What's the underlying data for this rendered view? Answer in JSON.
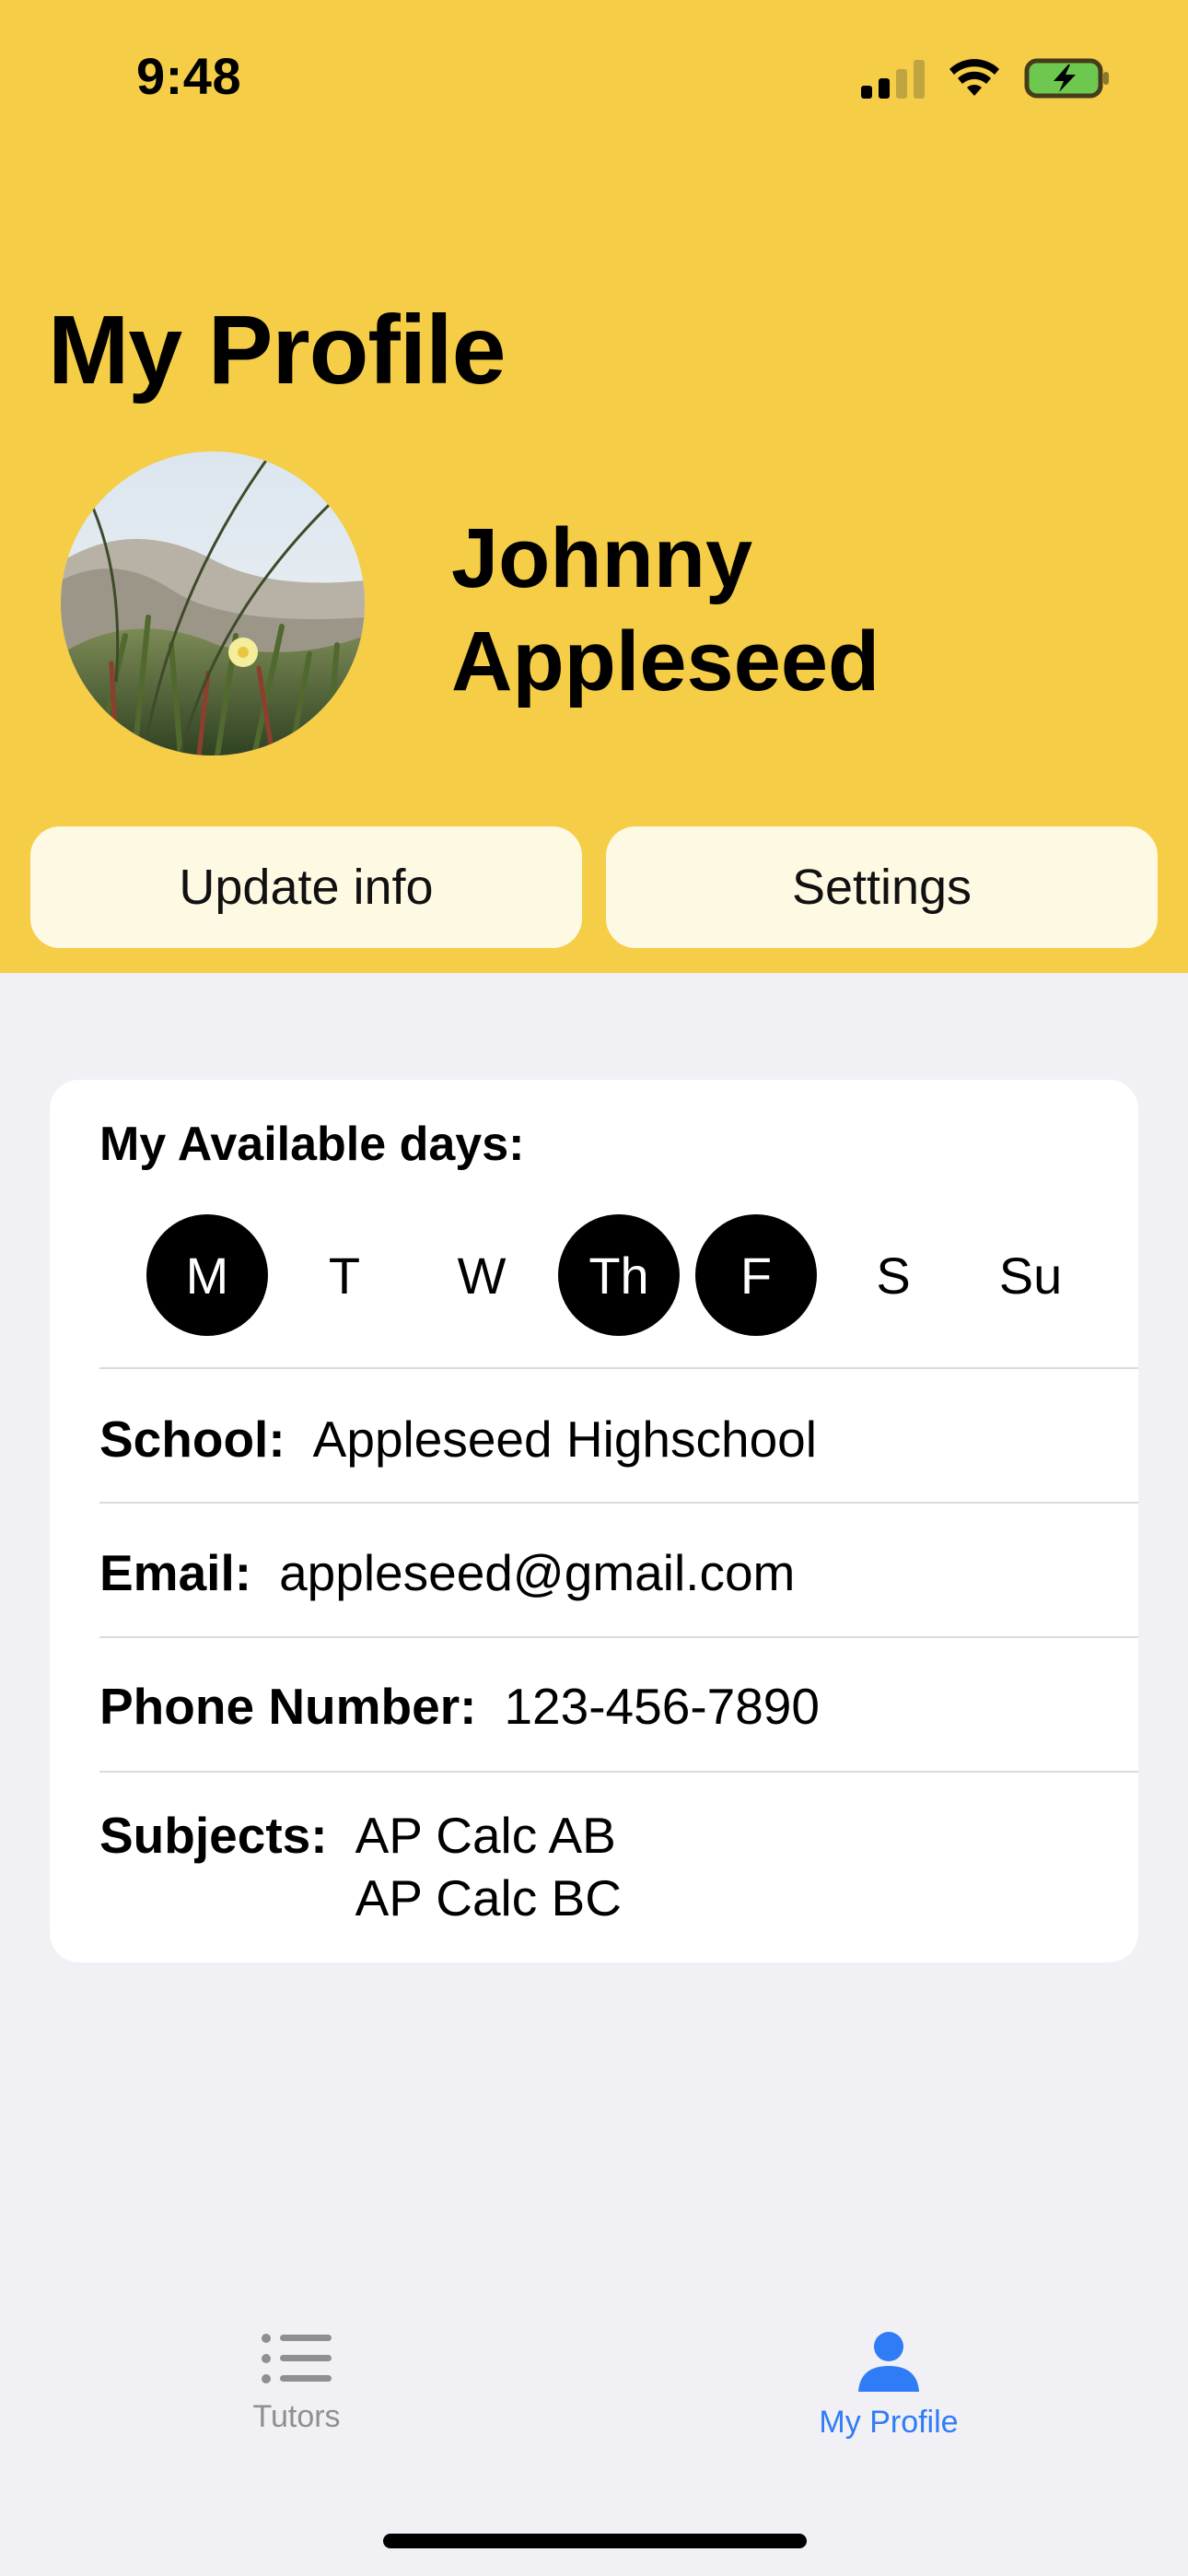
{
  "status_bar": {
    "time": "9:48"
  },
  "header": {
    "title": "My Profile",
    "name_first": "Johnny",
    "name_last": "Appleseed",
    "update_button": "Update info",
    "settings_button": "Settings",
    "background_color": "#F5CD47"
  },
  "availability": {
    "label": "My Available days:",
    "days": [
      {
        "label": "M",
        "selected": true
      },
      {
        "label": "T",
        "selected": false
      },
      {
        "label": "W",
        "selected": false
      },
      {
        "label": "Th",
        "selected": true
      },
      {
        "label": "F",
        "selected": true
      },
      {
        "label": "S",
        "selected": false
      },
      {
        "label": "Su",
        "selected": false
      }
    ]
  },
  "details": {
    "school_label": "School:",
    "school_value": "Appleseed Highschool",
    "email_label": "Email:",
    "email_value": "appleseed@gmail.com",
    "phone_label": "Phone Number:",
    "phone_value": "123-456-7890",
    "subjects_label": "Subjects:",
    "subjects": [
      "AP Calc AB",
      "AP Calc BC"
    ]
  },
  "tab_bar": {
    "tutors_label": "Tutors",
    "profile_label": "My Profile",
    "active_color": "#2F7CF6",
    "inactive_color": "#8E8E93"
  }
}
